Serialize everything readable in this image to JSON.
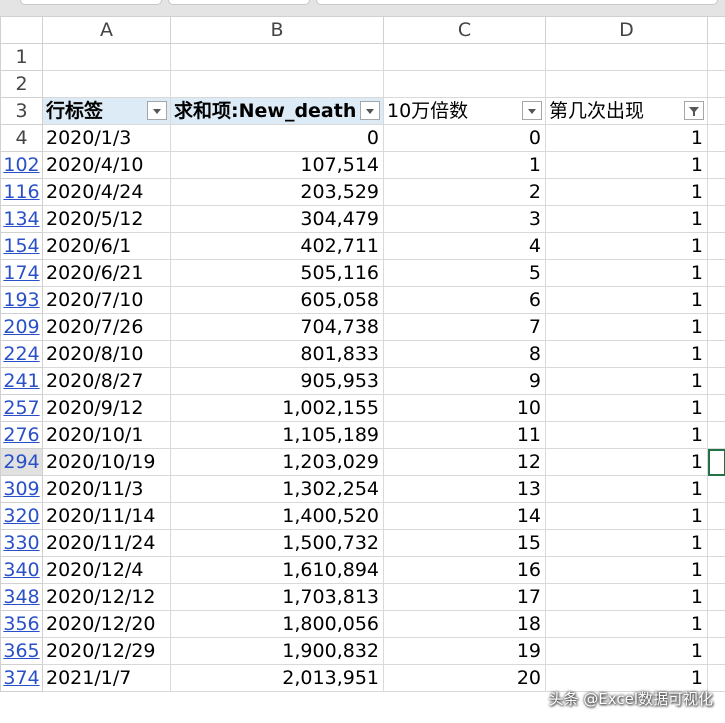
{
  "columns": [
    "A",
    "B",
    "C",
    "D"
  ],
  "header_row": {
    "row_number": "3",
    "a": "行标签",
    "b": "求和项:New_death",
    "c": "10万倍数",
    "d": "第几次出现"
  },
  "empty_rows": [
    "1",
    "2"
  ],
  "rows": [
    {
      "row": "4",
      "date": "2020/1/3",
      "deaths": "0",
      "multiple": "0",
      "occurrence": "1"
    },
    {
      "row": "102",
      "date": "2020/4/10",
      "deaths": "107,514",
      "multiple": "1",
      "occurrence": "1"
    },
    {
      "row": "116",
      "date": "2020/4/24",
      "deaths": "203,529",
      "multiple": "2",
      "occurrence": "1"
    },
    {
      "row": "134",
      "date": "2020/5/12",
      "deaths": "304,479",
      "multiple": "3",
      "occurrence": "1"
    },
    {
      "row": "154",
      "date": "2020/6/1",
      "deaths": "402,711",
      "multiple": "4",
      "occurrence": "1"
    },
    {
      "row": "174",
      "date": "2020/6/21",
      "deaths": "505,116",
      "multiple": "5",
      "occurrence": "1"
    },
    {
      "row": "193",
      "date": "2020/7/10",
      "deaths": "605,058",
      "multiple": "6",
      "occurrence": "1"
    },
    {
      "row": "209",
      "date": "2020/7/26",
      "deaths": "704,738",
      "multiple": "7",
      "occurrence": "1"
    },
    {
      "row": "224",
      "date": "2020/8/10",
      "deaths": "801,833",
      "multiple": "8",
      "occurrence": "1"
    },
    {
      "row": "241",
      "date": "2020/8/27",
      "deaths": "905,953",
      "multiple": "9",
      "occurrence": "1"
    },
    {
      "row": "257",
      "date": "2020/9/12",
      "deaths": "1,002,155",
      "multiple": "10",
      "occurrence": "1"
    },
    {
      "row": "276",
      "date": "2020/10/1",
      "deaths": "1,105,189",
      "multiple": "11",
      "occurrence": "1"
    },
    {
      "row": "294",
      "date": "2020/10/19",
      "deaths": "1,203,029",
      "multiple": "12",
      "occurrence": "1"
    },
    {
      "row": "309",
      "date": "2020/11/3",
      "deaths": "1,302,254",
      "multiple": "13",
      "occurrence": "1"
    },
    {
      "row": "320",
      "date": "2020/11/14",
      "deaths": "1,400,520",
      "multiple": "14",
      "occurrence": "1"
    },
    {
      "row": "330",
      "date": "2020/11/24",
      "deaths": "1,500,732",
      "multiple": "15",
      "occurrence": "1"
    },
    {
      "row": "340",
      "date": "2020/12/4",
      "deaths": "1,610,894",
      "multiple": "16",
      "occurrence": "1"
    },
    {
      "row": "348",
      "date": "2020/12/12",
      "deaths": "1,703,813",
      "multiple": "17",
      "occurrence": "1"
    },
    {
      "row": "356",
      "date": "2020/12/20",
      "deaths": "1,800,056",
      "multiple": "18",
      "occurrence": "1"
    },
    {
      "row": "365",
      "date": "2020/12/29",
      "deaths": "1,900,832",
      "multiple": "19",
      "occurrence": "1"
    },
    {
      "row": "374",
      "date": "2021/1/7",
      "deaths": "2,013,951",
      "multiple": "20",
      "occurrence": "1"
    }
  ],
  "active_row": "294",
  "watermark": "头条 @Excel数据可视化",
  "colors": {
    "pivot_header_bg": "#ddebf7",
    "row_link": "#2a50c8",
    "selection": "#217346"
  }
}
